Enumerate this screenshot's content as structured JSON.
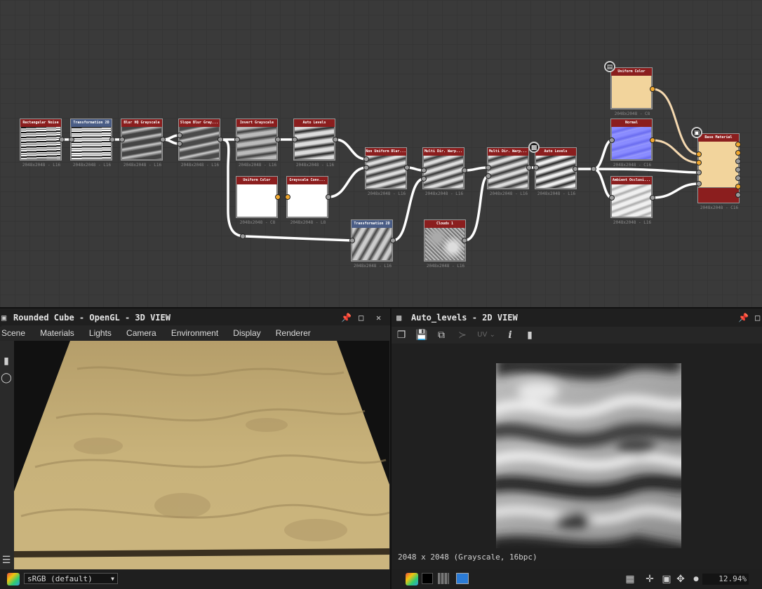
{
  "graph": {
    "nodes": [
      {
        "id": "n1",
        "title": "Rectangular Noise",
        "res": "2048x2048 - L16",
        "header": "#8b1e1e",
        "thumb": "noise-lines"
      },
      {
        "id": "n2",
        "title": "Transformation 2D",
        "res": "2048x2048 - L16",
        "header": "#4a5d86",
        "thumb": "noise-lines"
      },
      {
        "id": "n3",
        "title": "Blur HQ Grayscale",
        "res": "2048x2048 - L16",
        "header": "#8b1e1e",
        "thumb": "waves"
      },
      {
        "id": "n4",
        "title": "Slope Blur Gray...",
        "res": "2048x2048 - L16",
        "header": "#8b1e1e",
        "thumb": "waves"
      },
      {
        "id": "n5",
        "title": "Invert Grayscale",
        "res": "2048x2048 - L16",
        "header": "#8b1e1e",
        "thumb": "waves"
      },
      {
        "id": "n6",
        "title": "Auto Levels",
        "res": "2048x2048 - L16",
        "header": "#8b1e1e",
        "thumb": "waves"
      },
      {
        "id": "n7",
        "title": "Uniform Color",
        "res": "2048x2048 - C8",
        "header": "#8b1e1e",
        "thumb": "white"
      },
      {
        "id": "n8",
        "title": "Grayscale Conv...",
        "res": "2048x2048 - L8",
        "header": "#8b1e1e",
        "thumb": "white"
      },
      {
        "id": "n9",
        "title": "Non Uniform Blur...",
        "res": "2048x2048 - L16",
        "header": "#8b1e1e",
        "thumb": "waves"
      },
      {
        "id": "n10",
        "title": "Transformation 2D",
        "res": "2048x2048 - L16",
        "header": "#4a5d86",
        "thumb": "waves"
      },
      {
        "id": "n11",
        "title": "Multi Dir. Warp...",
        "res": "2048x2048 - L16",
        "header": "#8b1e1e",
        "thumb": "waves"
      },
      {
        "id": "n12",
        "title": "Clouds 1",
        "res": "2048x2048 - L16",
        "header": "#8b1e1e",
        "thumb": "noise"
      },
      {
        "id": "n13",
        "title": "Multi Dir. Warp...",
        "res": "2048x2048 - L16",
        "header": "#8b1e1e",
        "thumb": "waves"
      },
      {
        "id": "n14",
        "title": "Auto Levels",
        "res": "2048x2048 - L16",
        "header": "#8b1e1e",
        "thumb": "waves"
      },
      {
        "id": "n15",
        "title": "Uniform Color",
        "res": "2048x2048 - C8",
        "header": "#8b1e1e",
        "thumb": "sand"
      },
      {
        "id": "n16",
        "title": "Normal",
        "res": "2048x2048 - C16",
        "header": "#8b1e1e",
        "thumb": "normal"
      },
      {
        "id": "n17",
        "title": "Ambient Occlusi...",
        "res": "2048x2048 - L16",
        "header": "#8b1e1e",
        "thumb": "ao"
      },
      {
        "id": "n18",
        "title": "Base Material",
        "res": "2048x2048 - C16",
        "header": "#8b1e1e",
        "thumb": "sand"
      }
    ]
  },
  "view3d": {
    "title": "Rounded Cube - OpenGL - 3D VIEW",
    "menu": [
      "Scene",
      "Materials",
      "Lights",
      "Camera",
      "Environment",
      "Display",
      "Renderer"
    ],
    "colorspace": "sRGB (default)",
    "surface_color": "#c8b27a"
  },
  "view2d": {
    "title": "Auto_levels - 2D VIEW",
    "uv_label": "UV",
    "info_label": "i",
    "status": "2048 x 2048 (Grayscale, 16bpc)",
    "zoom": "12.94%"
  }
}
